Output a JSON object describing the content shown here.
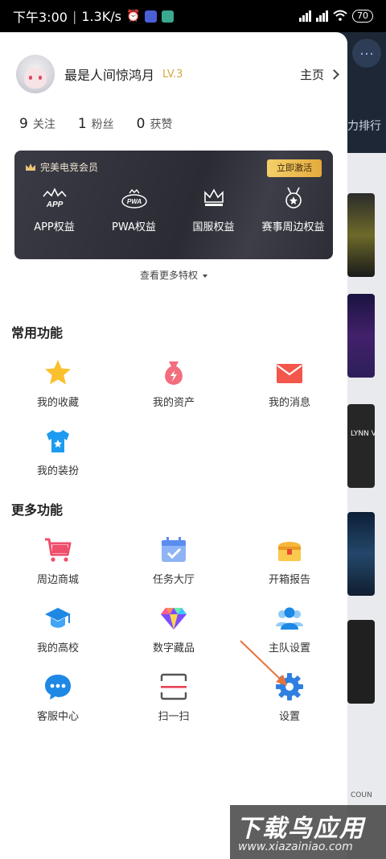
{
  "status_bar": {
    "time": "下午3:00",
    "speed": "1.3K/s",
    "battery": "70"
  },
  "background_app": {
    "rank_text": "力排行",
    "card_text": "LYNN V",
    "bottom_text": "COUN"
  },
  "profile": {
    "username": "最是人间惊鸿月",
    "level": "LV.3",
    "homepage_label": "主页"
  },
  "stats": [
    {
      "value": "9",
      "label": "关注"
    },
    {
      "value": "1",
      "label": "粉丝"
    },
    {
      "value": "0",
      "label": "获赞"
    }
  ],
  "vip": {
    "title": "完美电竞会员",
    "activate_button": "立即激活",
    "perks": [
      {
        "label": "APP权益",
        "icon": "app-crown-icon"
      },
      {
        "label": "PWA权益",
        "icon": "pwa-crown-icon"
      },
      {
        "label": "国服权益",
        "icon": "crown-icon"
      },
      {
        "label": "赛事周边权益",
        "icon": "medal-icon"
      }
    ],
    "more_perks": "查看更多特权"
  },
  "common_section": {
    "title": "常用功能",
    "items": [
      {
        "label": "我的收藏",
        "icon": "star-icon"
      },
      {
        "label": "我的资产",
        "icon": "money-bag-icon"
      },
      {
        "label": "我的消息",
        "icon": "envelope-icon"
      },
      {
        "label": "我的装扮",
        "icon": "tshirt-icon"
      }
    ]
  },
  "more_section": {
    "title": "更多功能",
    "items": [
      {
        "label": "周边商城",
        "icon": "cart-icon"
      },
      {
        "label": "任务大厅",
        "icon": "calendar-icon"
      },
      {
        "label": "开箱报告",
        "icon": "treasure-box-icon"
      },
      {
        "label": "我的高校",
        "icon": "graduation-cap-icon"
      },
      {
        "label": "数字藏品",
        "icon": "diamond-icon"
      },
      {
        "label": "主队设置",
        "icon": "team-icon"
      },
      {
        "label": "客服中心",
        "icon": "chat-bubble-icon"
      },
      {
        "label": "扫一扫",
        "icon": "scan-icon"
      },
      {
        "label": "设置",
        "icon": "gear-icon"
      }
    ]
  },
  "watermark": {
    "title": "下载鸟应用",
    "url": "www.xiazainiao.com"
  },
  "colors": {
    "level_gold": "#d9a640",
    "vip_dark": "#2f3039",
    "vip_button": "#f0bf54",
    "annotation_arrow": "#e8733a"
  }
}
